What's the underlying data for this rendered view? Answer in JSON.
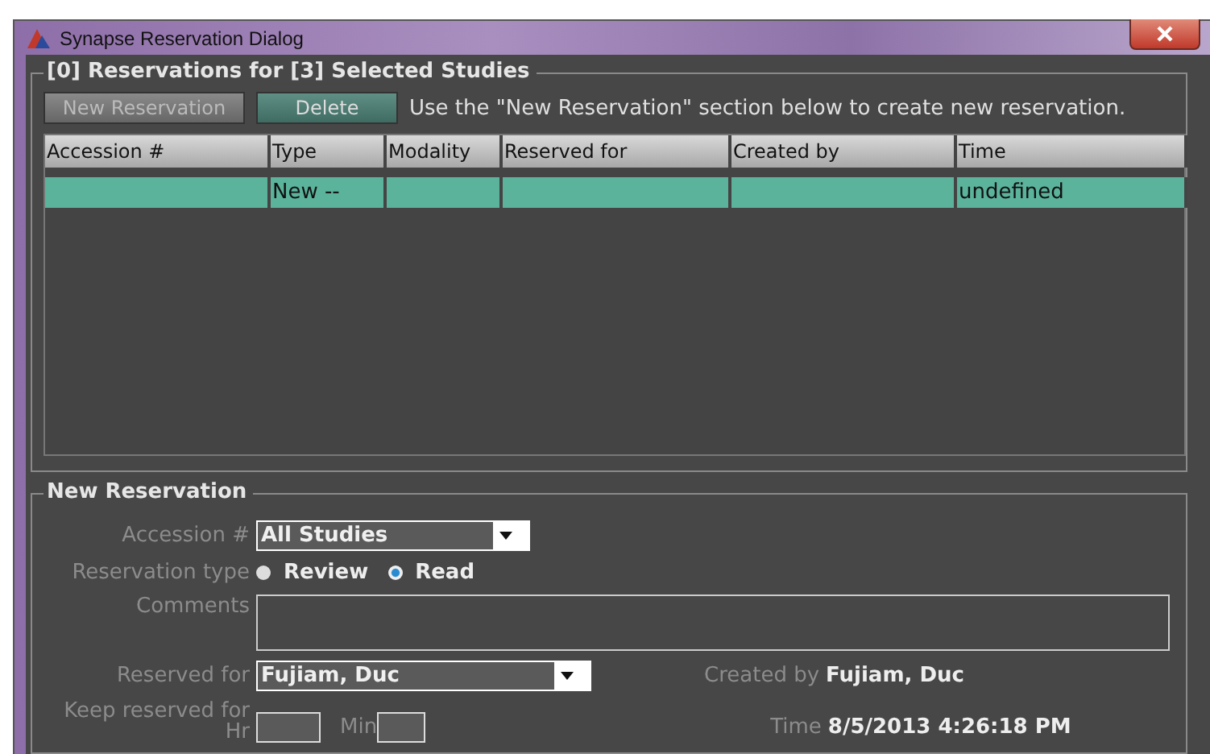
{
  "window": {
    "title": "Synapse Reservation Dialog"
  },
  "reservations": {
    "legend": "[0] Reservations for [3] Selected Studies",
    "buttons": [
      {
        "label": "New Reservation",
        "disabled": true
      },
      {
        "label": "Delete",
        "disabled": false
      }
    ],
    "hint": "Use the \"New Reservation\" section below to create new reservation.",
    "columns": [
      "Accession #",
      "Type",
      "Modality",
      "Reserved for",
      "Created by",
      "Time"
    ],
    "rows": [
      {
        "selected": true,
        "cells": [
          "",
          "New --",
          "",
          "",
          "",
          "undefined"
        ]
      }
    ]
  },
  "new_reservation": {
    "legend": "New Reservation",
    "accession": {
      "label": "Accession #",
      "value": "All Studies"
    },
    "type": {
      "label": "Reservation type",
      "options": [
        {
          "label": "Review",
          "selected": false
        },
        {
          "label": "Read",
          "selected": true
        }
      ]
    },
    "comments": {
      "label": "Comments"
    },
    "reserved_for": {
      "label": "Reserved for",
      "value": "Fujiam, Duc"
    },
    "created_by": {
      "label": "Created by",
      "value": "Fujiam, Duc"
    },
    "keep": {
      "label": "Keep reserved for",
      "hr_label": "Hr",
      "min_label": "Min"
    },
    "time": {
      "label": "Time",
      "value": "8/5/2013 4:26:18 PM"
    }
  }
}
